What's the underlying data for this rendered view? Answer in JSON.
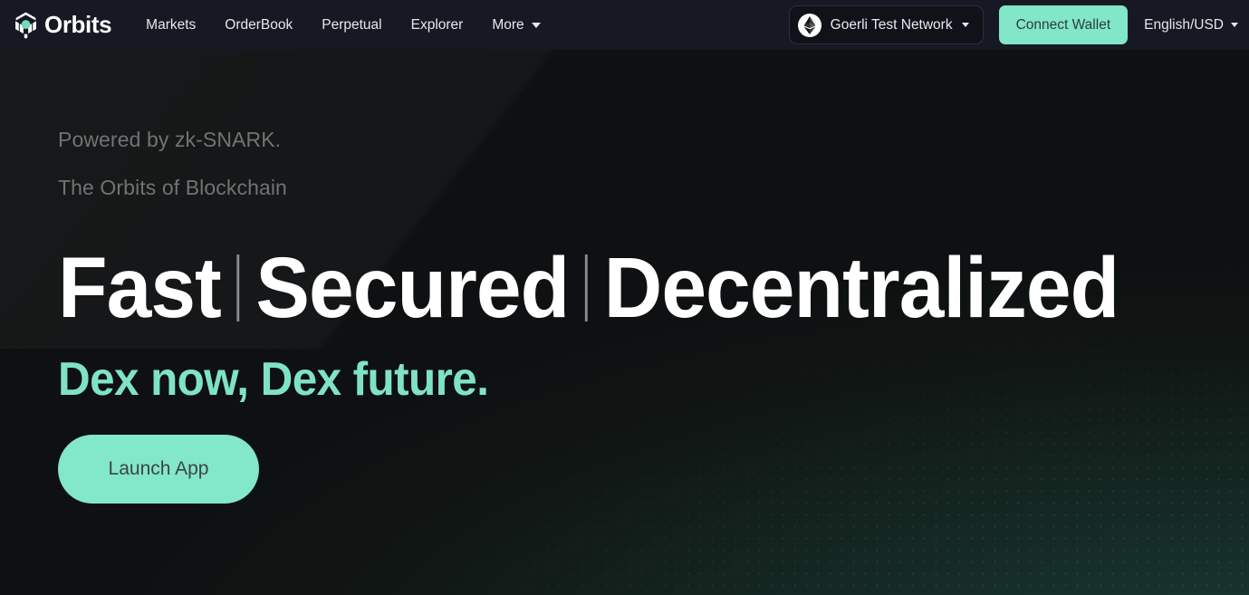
{
  "brand": {
    "name": "Orbits",
    "logo_icon": "orbits-cube-logo-icon"
  },
  "nav": {
    "links": [
      {
        "label": "Markets"
      },
      {
        "label": "OrderBook"
      },
      {
        "label": "Perpetual"
      },
      {
        "label": "Explorer"
      }
    ],
    "more": {
      "label": "More",
      "icon": "chevron-down-icon"
    }
  },
  "network": {
    "label": "Goerli Test Network",
    "chain_icon": "ethereum-icon",
    "caret_icon": "chevron-down-icon"
  },
  "wallet": {
    "connect_label": "Connect Wallet"
  },
  "locale": {
    "label": "English/USD",
    "caret_icon": "chevron-down-icon"
  },
  "hero": {
    "eyebrow_line_1": "Powered by zk-SNARK.",
    "eyebrow_line_2": "The Orbits of Blockchain",
    "headline_words": [
      "Fast",
      "Secured",
      "Decentralized"
    ],
    "subheadline": "Dex now, Dex future.",
    "cta_label": "Launch App"
  },
  "colors": {
    "accent_teal": "#83e7c9",
    "subheadline_teal": "#7fe3c3",
    "navbar_bg": "#161923",
    "hero_bg": "#0e1011",
    "nav_text": "#e6e8ec",
    "eyebrow_text": "#6f7472",
    "headline_text": "#ffffff",
    "cta_text": "#3c4545"
  }
}
